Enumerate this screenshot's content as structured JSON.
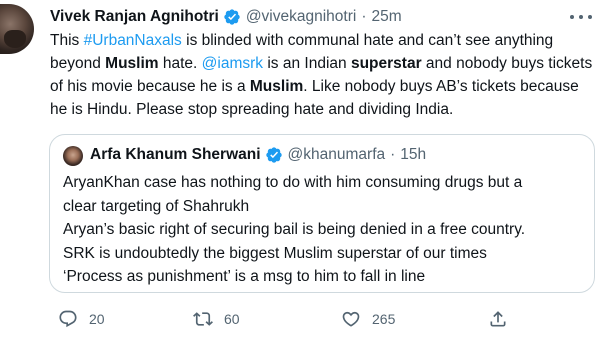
{
  "tweet": {
    "author": {
      "name": "Vivek Ranjan Agnihotri",
      "handle": "@vivekagnihotri"
    },
    "separator": "·",
    "time": "25m",
    "segments": [
      {
        "text": "This ",
        "style": "normal"
      },
      {
        "text": "#UrbanNaxals",
        "style": "link"
      },
      {
        "text": " is blinded with communal hate and can’t see anything beyond ",
        "style": "normal"
      },
      {
        "text": "Muslim",
        "style": "bold"
      },
      {
        "text": " hate. ",
        "style": "normal"
      },
      {
        "text": "@iamsrk",
        "style": "link"
      },
      {
        "text": " is an Indian ",
        "style": "normal"
      },
      {
        "text": "superstar",
        "style": "bold"
      },
      {
        "text": " and nobody buys tickets of his movie because he is a ",
        "style": "normal"
      },
      {
        "text": "Muslim",
        "style": "bold"
      },
      {
        "text": ". Like nobody buys AB’s tickets because he is Hindu. Please stop spreading hate and dividing India.",
        "style": "normal"
      }
    ],
    "quoted": {
      "author": {
        "name": "Arfa Khanum Sherwani",
        "handle": "@khanumarfa"
      },
      "separator": "·",
      "time": "15h",
      "lines": [
        "AryanKhan case has nothing to do with him consuming drugs but a",
        "clear targeting of Shahrukh",
        "Aryan’s basic right of securing bail is being denied in a free country.",
        "SRK is undoubtedly the biggest Muslim superstar of our times",
        "‘Process as punishment’ is a msg to him to fall in line"
      ]
    },
    "metrics": {
      "replies": "20",
      "retweets": "60",
      "likes": "265"
    }
  },
  "colors": {
    "text": "#0f1419",
    "secondary": "#536471",
    "link": "#1d9bf0",
    "verified": "#1d9bf0",
    "border": "#cfd9de"
  },
  "icons": {
    "verified": "verified-badge-icon",
    "more": "more-options-icon",
    "reply": "reply-icon",
    "retweet": "retweet-icon",
    "like": "heart-icon",
    "share": "share-icon"
  }
}
